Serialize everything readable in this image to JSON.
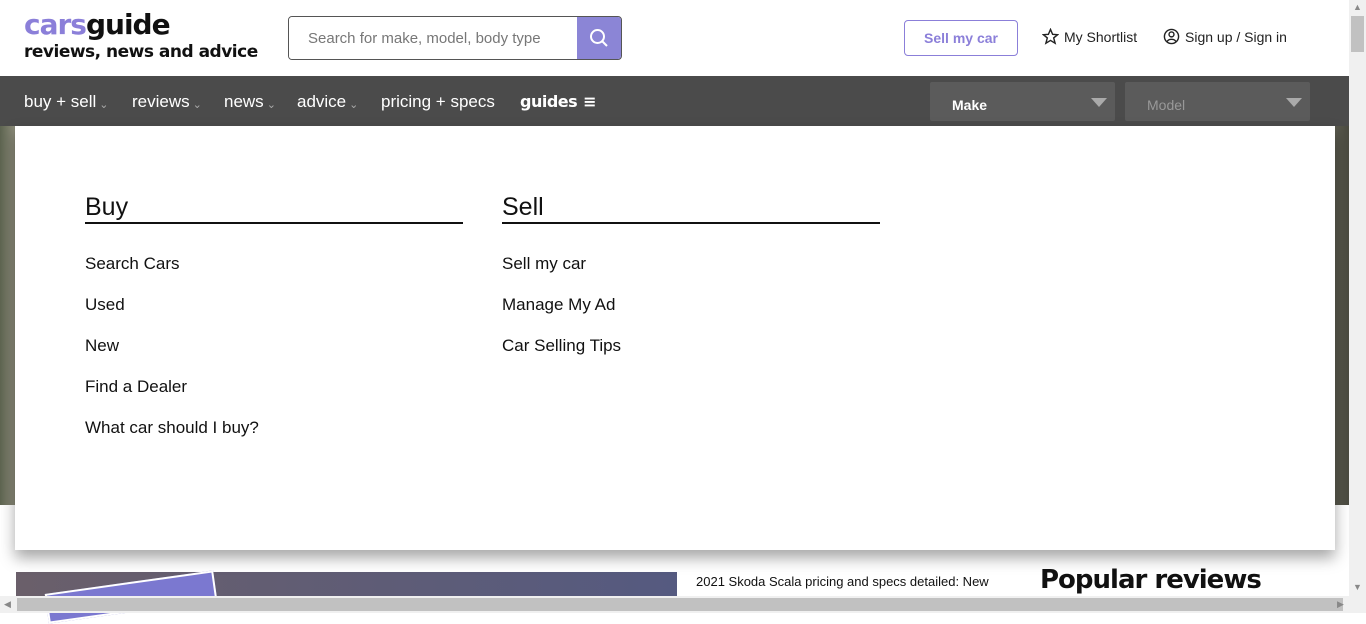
{
  "header": {
    "logo_cars": "cars",
    "logo_guide": "guide",
    "tagline": "reviews, news and advice",
    "search_placeholder": "Search for make, model, body type",
    "sell_button": "Sell my car",
    "shortlist": "My Shortlist",
    "signin": "Sign up / Sign in"
  },
  "nav": {
    "items": [
      {
        "label": "buy + sell"
      },
      {
        "label": "reviews"
      },
      {
        "label": "news"
      },
      {
        "label": "advice"
      },
      {
        "label": "pricing + specs"
      },
      {
        "label": "guides"
      }
    ],
    "make": "Make",
    "model": "Model"
  },
  "menu": {
    "buy": {
      "title": "Buy",
      "links": [
        "Search Cars",
        "Used",
        "New",
        "Find a Dealer",
        "What car should I buy?"
      ]
    },
    "sell": {
      "title": "Sell",
      "links": [
        "Sell my car",
        "Manage My Ad",
        "Car Selling Tips"
      ]
    }
  },
  "content": {
    "headline": "2021 Skoda Scala pricing and specs detailed: New",
    "popular_title": "Popular reviews"
  },
  "colors": {
    "accent": "#8b7fd9",
    "nav_bg": "#4b4b4b"
  }
}
